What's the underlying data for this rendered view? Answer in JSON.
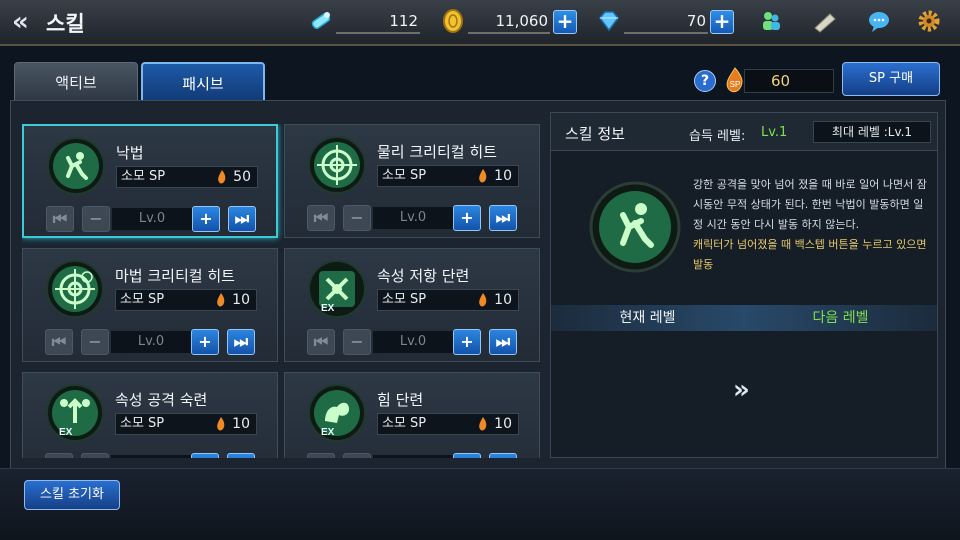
{
  "header": {
    "title": "스킬",
    "resources": [
      {
        "icon": "energy-icon",
        "value": "112"
      },
      {
        "icon": "gold-coin-icon",
        "value": "11,060"
      },
      {
        "icon": "diamond-icon",
        "value": "70"
      }
    ]
  },
  "tabs": [
    {
      "label": "액티브",
      "active": false
    },
    {
      "label": "패시브",
      "active": true
    }
  ],
  "sp": {
    "value": "60",
    "buy_label": "SP 구매"
  },
  "cost_label": "소모 SP",
  "skills": [
    {
      "name": "낙법",
      "cost": "50",
      "level": "Lv.0",
      "selected": true
    },
    {
      "name": "물리 크리티컬 히트",
      "cost": "10",
      "level": "Lv.0"
    },
    {
      "name": "마법 크리티컬 히트",
      "cost": "10",
      "level": "Lv.0"
    },
    {
      "name": "속성 저항 단련",
      "cost": "10",
      "level": "Lv.0"
    },
    {
      "name": "속성 공격 숙련",
      "cost": "10",
      "level": ""
    },
    {
      "name": "힘 단련",
      "cost": "10",
      "level": ""
    }
  ],
  "info": {
    "title": "스킬 정보",
    "acquired_label": "습득 레벨:",
    "acquired_value": "Lv.1",
    "max_label": "최대 레벨 :Lv.1",
    "description": "강한 공격을 맞아 넘어 졌을 때 바로 일어 나면서 잠시동안 무적 상태가 된다. 한번 낙법이 발동하면 일정 시간 동안 다시 발동 하지 않는다.",
    "description_highlight": "캐릭터가 넘어졌을 때 백스텝 버튼을 누르고 있으면 발동",
    "current_level_label": "현재 레벨",
    "next_level_label": "다음 레벨",
    "arrows": "»"
  },
  "reset_label": "스킬 초기화",
  "colors": {
    "accent": "#3fc8d6",
    "green": "#7ee04d",
    "blue": "#1d5aa6"
  }
}
